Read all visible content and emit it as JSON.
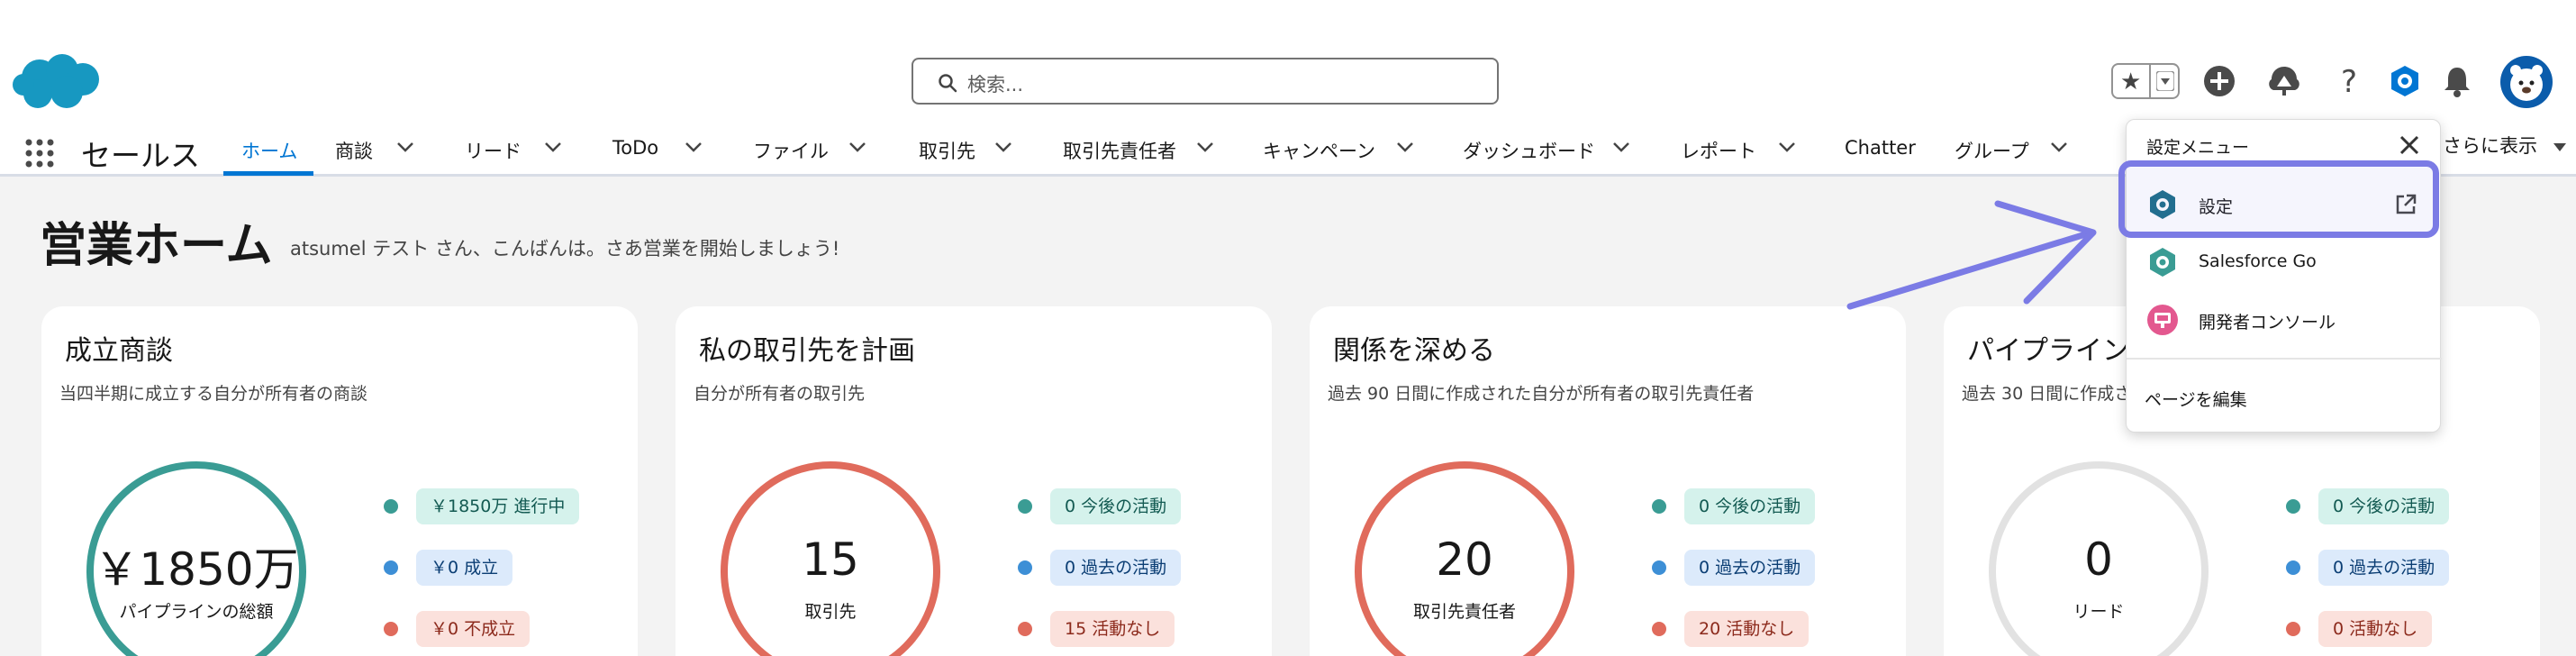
{
  "colors": {
    "brand_blue": "#0176d3",
    "teal": "#3a9c94",
    "salmon": "#e06b5c",
    "highlight": "#7b7be5"
  },
  "header": {
    "search_placeholder": "検索...",
    "icons": [
      "star-icon",
      "chevron-down-icon",
      "add-icon",
      "trailhead-icon",
      "help-icon",
      "gear-icon",
      "bell-icon",
      "avatar"
    ]
  },
  "nav": {
    "app_name": "セールス",
    "items": [
      "ホーム",
      "商談",
      "リード",
      "ToDo",
      "ファイル",
      "取引先",
      "取引先責任者",
      "キャンペーン",
      "ダッシュボード",
      "レポート",
      "Chatter",
      "グループ"
    ],
    "overflow_label": "さらに表示"
  },
  "page": {
    "title": "営業ホーム",
    "welcome": "atsumel テスト さん、こんばんは。さあ営業を開始しましょう!"
  },
  "cards": [
    {
      "title": "成立商談",
      "subtitle": "当四半期に成立する自分が所有者の商談",
      "big": "￥1850万",
      "label": "パイプラインの総額",
      "pills": [
        "￥1850万 進行中",
        "￥0 成立",
        "￥0 不成立"
      ]
    },
    {
      "title": "私の取引先を計画",
      "subtitle": "自分が所有者の取引先",
      "big": "15",
      "label": "取引先",
      "pills": [
        "0 今後の活動",
        "0 過去の活動",
        "15 活動なし"
      ]
    },
    {
      "title": "関係を深める",
      "subtitle": "過去 90 日間に作成された自分が所有者の取引先責任者",
      "big": "20",
      "label": "取引先責任者",
      "pills": [
        "0 今後の活動",
        "0 過去の活動",
        "20 活動なし"
      ]
    },
    {
      "title": "パイプライン",
      "subtitle": "過去 30 日間に作成さ",
      "big": "0",
      "label": "リード",
      "pills": [
        "0 今後の活動",
        "0 過去の活動",
        "0 活動なし"
      ]
    }
  ],
  "settings_menu": {
    "title": "設定メニュー",
    "items": [
      "設定",
      "Salesforce Go",
      "開発者コンソール"
    ],
    "edit_page": "ページを編集"
  }
}
